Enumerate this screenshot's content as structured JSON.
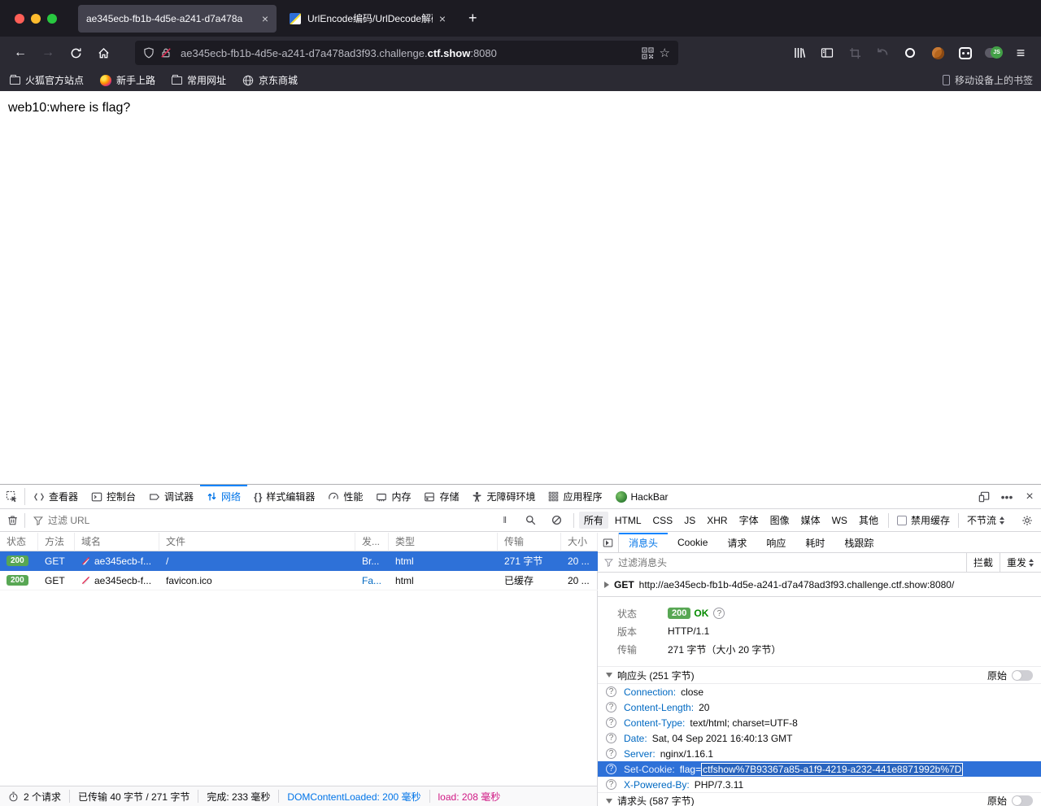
{
  "browser": {
    "tabs": [
      {
        "title": "ae345ecb-fb1b-4d5e-a241-d7a478a",
        "close": "×"
      },
      {
        "title": "UrlEncode编码/UrlDecode解码 -",
        "close": "×"
      }
    ],
    "new_tab": "+",
    "url": {
      "prefix": "ae345ecb-fb1b-4d5e-a241-d7a478ad3f93.challenge.",
      "domain": "ctf.show",
      "port": ":8080"
    },
    "star": "☆",
    "menu": "≡",
    "bookmarks": [
      "火狐官方站点",
      "新手上路",
      "常用网址",
      "京东商城"
    ],
    "bookmarks_right": "移动设备上的书签"
  },
  "page": {
    "text": "web10:where is flag?"
  },
  "devtools": {
    "tabs": [
      "查看器",
      "控制台",
      "调试器",
      "网络",
      "样式编辑器",
      "性能",
      "内存",
      "存储",
      "无障碍环境",
      "应用程序",
      "HackBar"
    ],
    "more": "•••",
    "close": "×",
    "filter": {
      "placeholder": "过滤 URL",
      "pause": "‖",
      "types": [
        "所有",
        "HTML",
        "CSS",
        "JS",
        "XHR",
        "字体",
        "图像",
        "媒体",
        "WS",
        "其他"
      ],
      "cache_label": "禁用缓存",
      "throttle_label": "不节流"
    },
    "table": {
      "headers": [
        "状态",
        "方法",
        "域名",
        "文件",
        "发...",
        "类型",
        "传输",
        "大小"
      ],
      "rows": [
        {
          "status": "200",
          "method": "GET",
          "domain": "ae345ecb-f...",
          "file": "/",
          "initiator": "Br...",
          "type": "html",
          "transferred": "271 字节",
          "size": "20 ..."
        },
        {
          "status": "200",
          "method": "GET",
          "domain": "ae345ecb-f...",
          "file": "favicon.ico",
          "initiator": "Fa...",
          "type": "html",
          "transferred": "已缓存",
          "size": "20 ..."
        }
      ]
    },
    "status_bar": {
      "requests": "2 个请求",
      "transferred": "已传输 40 字节 / 271 字节",
      "finish": "完成: 233 毫秒",
      "dom": "DOMContentLoaded: 200 毫秒",
      "load": "load: 208 毫秒"
    },
    "details": {
      "tabs": [
        "消息头",
        "Cookie",
        "请求",
        "响应",
        "耗时",
        "栈跟踪"
      ],
      "filter_placeholder": "过滤消息头",
      "block_btn": "拦截",
      "resend_btn": "重发",
      "request": {
        "method": "GET",
        "url": "http://ae345ecb-fb1b-4d5e-a241-d7a478ad3f93.challenge.ctf.show:8080/"
      },
      "summary": {
        "status_label": "状态",
        "status_code": "200",
        "status_text": "OK",
        "version_label": "版本",
        "version": "HTTP/1.1",
        "transfer_label": "传输",
        "transfer": "271 字节（大小 20 字节）"
      },
      "response_section": {
        "title": "响应头 (251 字节)",
        "raw_label": "原始"
      },
      "response_headers": [
        {
          "name": "Connection",
          "value": "close"
        },
        {
          "name": "Content-Length",
          "value": "20"
        },
        {
          "name": "Content-Type",
          "value": "text/html; charset=UTF-8"
        },
        {
          "name": "Date",
          "value": "Sat, 04 Sep 2021 16:40:13 GMT"
        },
        {
          "name": "Server",
          "value": "nginx/1.16.1"
        },
        {
          "name": "Set-Cookie",
          "value_prefix": "flag=",
          "value_selected": "ctfshow%7B93367a85-a1f9-4219-a232-441e8871992b%7D"
        },
        {
          "name": "X-Powered-By",
          "value": "PHP/7.3.11"
        }
      ],
      "request_section": {
        "title": "请求头 (587 字节)",
        "raw_label": "原始"
      }
    },
    "colors": {
      "accent": "#0a84ff",
      "selected_row": "#2e71d8",
      "status_green": "#58a754",
      "header_blue": "#0069c2",
      "load_pink": "#d01884"
    }
  }
}
